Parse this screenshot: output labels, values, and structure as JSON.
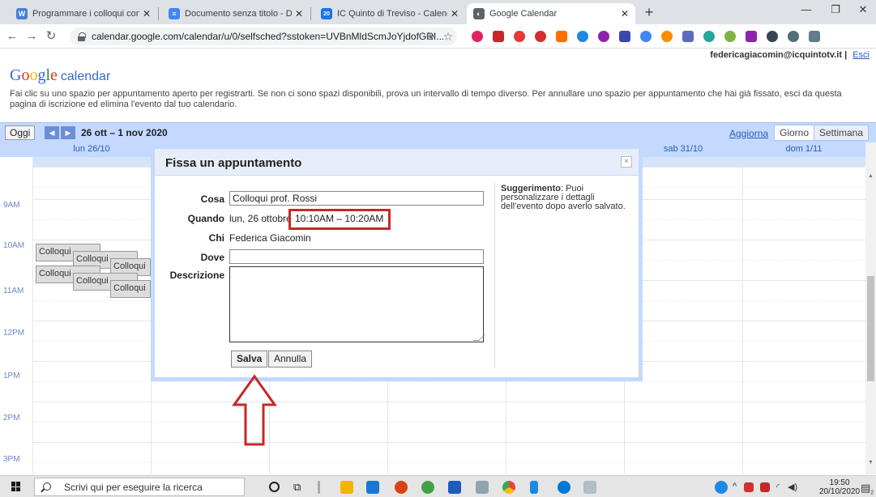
{
  "browser": {
    "tabs": [
      {
        "title": "Programmare i colloqui con Cale",
        "favicon_color": "#4a7fd6",
        "favicon_glyph": "W"
      },
      {
        "title": "Documento senza titolo - Docum",
        "favicon_color": "#4285f4",
        "favicon_glyph": "≡"
      },
      {
        "title": "IC Quinto di Treviso - Calendario",
        "favicon_color": "#1a73e8",
        "favicon_glyph": "20"
      },
      {
        "title": "Google Calendar",
        "favicon_color": "#5f6368",
        "favicon_glyph": "◐"
      }
    ],
    "url": "calendar.google.com/calendar/u/0/selfsched?sstoken=UVBnMldScmJoYjdofGRI...",
    "extension_colors": [
      "#e0245e",
      "#c62828",
      "#e53935",
      "#d32f2f",
      "#ff6f00",
      "#1e88e5",
      "#8e24aa",
      "#3949ab",
      "#4285f4",
      "#fb8c00",
      "#5c6bc0",
      "#26a69a",
      "#7cb342",
      "#8e24aa",
      "#37474f",
      "#546e7a",
      "#607d8b"
    ]
  },
  "calendar": {
    "user_email": "federicagiacomin@icquintotv.it",
    "sign_out": "Esci",
    "logo_letters": [
      "G",
      "o",
      "o",
      "g",
      "l",
      "e"
    ],
    "logo_suffix": "calendar",
    "info_text": "Fai clic su uno spazio per appuntamento aperto per registrarti. Se non ci sono spazi disponibili, prova un intervallo di tempo diverso. Per annullare uno spazio per appuntamento che hai già fissato, esci da questa pagina di iscrizione ed elimina l'evento dal tuo calendario.",
    "today_button": "Oggi",
    "prev": "◀",
    "next": "▶",
    "date_range": "26 ott – 1 nov 2020",
    "refresh": "Aggiorna",
    "views": [
      "Giorno",
      "Settimana"
    ],
    "days": [
      "lun 26/10",
      "",
      "",
      "",
      "",
      "sab 31/10",
      "dom 1/11"
    ],
    "hours": [
      "9AM",
      "10AM",
      "11AM",
      "12PM",
      "1PM",
      "2PM",
      "3PM"
    ],
    "events": [
      "Colloqui",
      "Colloqui",
      "Colloqui",
      "Colloqui",
      "Colloqui",
      "Colloqui"
    ]
  },
  "dialog": {
    "title": "Fissa un appuntamento",
    "close": "×",
    "what_label": "Cosa",
    "what_value": "Colloqui prof. Rossi",
    "when_label": "Quando",
    "when_date": "lun, 26 ottobre",
    "when_time": "10:10AM – 10:20AM",
    "who_label": "Chi",
    "who_value": "Federica Giacomin",
    "where_label": "Dove",
    "where_value": "",
    "description_label": "Descrizione",
    "description_value": "",
    "save_button": "Salva",
    "cancel_button": "Annulla",
    "hint_bold": "Suggerimento",
    "hint_text": ": Puoi personalizzare i dettagli dell'evento dopo averlo salvato."
  },
  "annotation": {
    "highlight_color": "#c62828",
    "arrow_color": "#c62828"
  },
  "taskbar": {
    "search_placeholder": "Scrivi qui per eseguire la ricerca",
    "time": "19:50",
    "date": "20/10/2020",
    "notification_count": "2"
  }
}
